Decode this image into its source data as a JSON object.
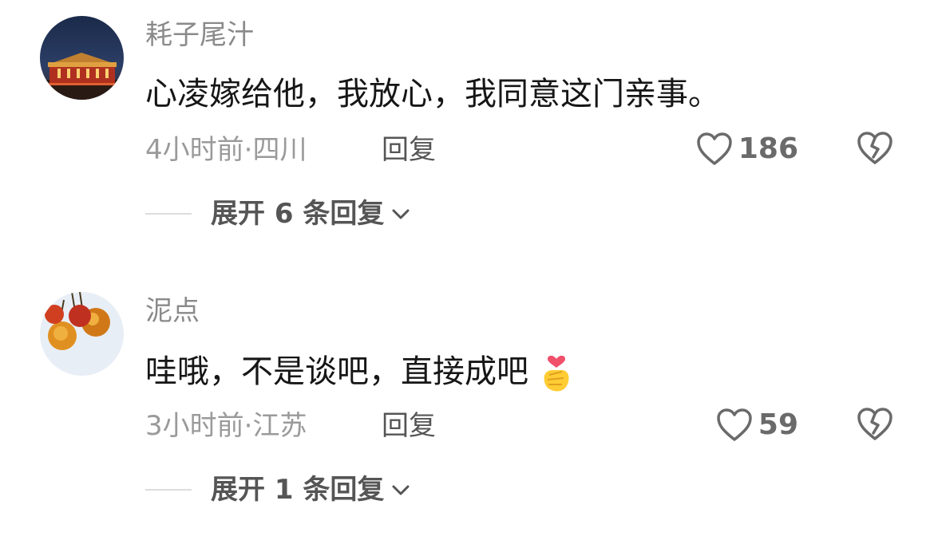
{
  "comments": [
    {
      "username": "耗子尾汁",
      "text": "心凌嫁给他，我放心，我同意这门亲事。",
      "emoji": "",
      "meta": "4小时前·四川",
      "reply_label": "回复",
      "like_count": "186",
      "expand_label": "展开 6 条回复",
      "avatar_icon": "tiananmen-night-avatar"
    },
    {
      "username": "泥点",
      "text": "哇哦，不是谈吧，直接成吧",
      "emoji": "finger-heart-emoji",
      "meta": "3小时前·江苏",
      "reply_label": "回复",
      "like_count": "59",
      "expand_label": "展开 1 条回复",
      "avatar_icon": "cherries-avatar"
    }
  ],
  "icons": {
    "like": "heart-outline-icon",
    "dislike": "broken-heart-icon",
    "expand": "chevron-down-icon"
  },
  "colors": {
    "username": "#8a8a8a",
    "text": "#161616",
    "meta": "#9a9a9a",
    "action": "#555555"
  }
}
